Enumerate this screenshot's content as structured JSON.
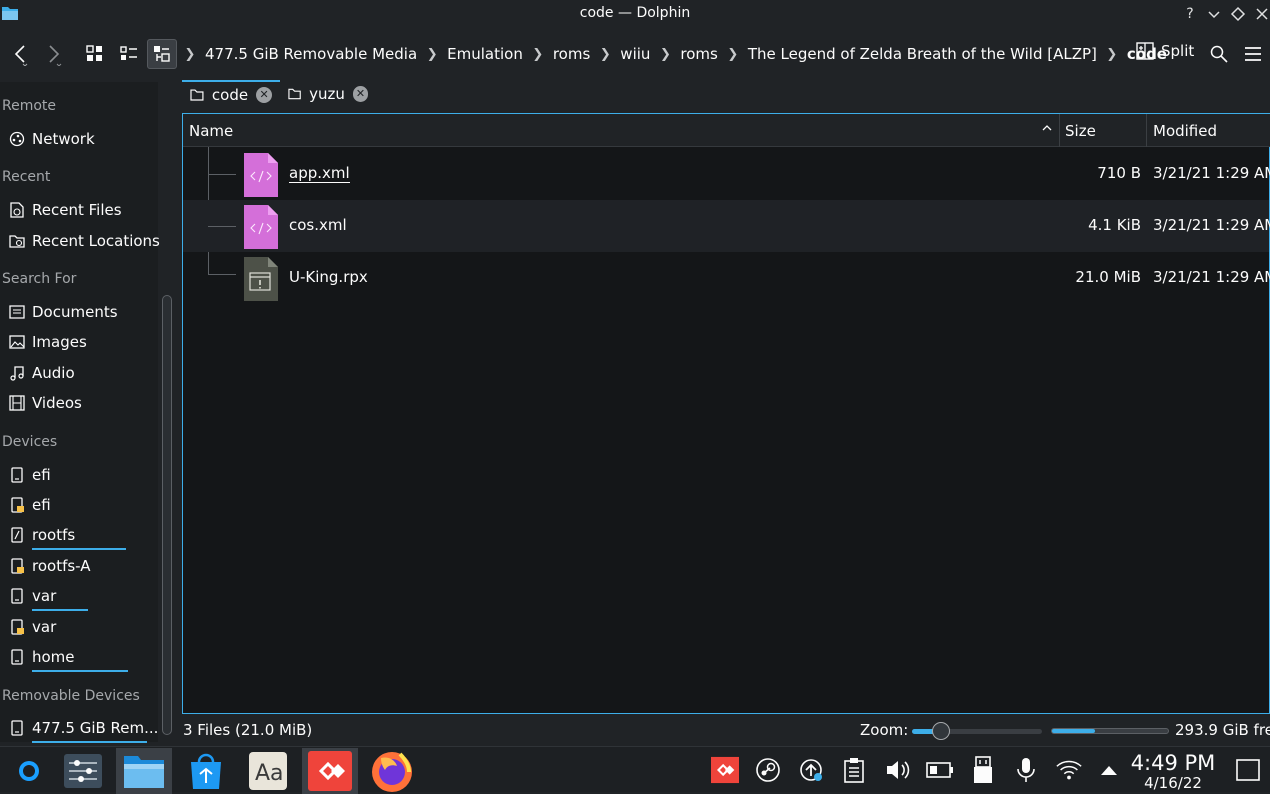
{
  "window": {
    "title": "code — Dolphin"
  },
  "toolbar": {
    "breadcrumb": [
      "477.5 GiB Removable Media",
      "Emulation",
      "roms",
      "wiiu",
      "roms",
      "The Legend of Zelda Breath of the Wild [ALZP]",
      "code"
    ],
    "split_label": "Split"
  },
  "sidebar": {
    "remote_heading": "Remote",
    "network": "Network",
    "recent_heading": "Recent",
    "recent_files": "Recent Files",
    "recent_locations": "Recent Locations",
    "search_heading": "Search For",
    "documents": "Documents",
    "images": "Images",
    "audio": "Audio",
    "videos": "Videos",
    "devices_heading": "Devices",
    "devices": [
      "efi",
      "efi",
      "rootfs",
      "rootfs-A",
      "var",
      "var",
      "home"
    ],
    "device_usage": [
      0,
      0,
      0.84,
      0,
      0.42,
      0,
      0.67
    ],
    "removable_heading": "Removable Devices",
    "removable": "477.5 GiB Rem...",
    "removable_usage": 0.37
  },
  "tabs": [
    {
      "label": "code",
      "active": true
    },
    {
      "label": "yuzu",
      "active": false
    }
  ],
  "columns": {
    "name": "Name",
    "size": "Size",
    "modified": "Modified"
  },
  "files": [
    {
      "name": "app.xml",
      "size": "710 B",
      "modified": "3/21/21 1:29 AM",
      "icon": "xml-file-icon"
    },
    {
      "name": "cos.xml",
      "size": "4.1 KiB",
      "modified": "3/21/21 1:29 AM",
      "icon": "xml-file-icon"
    },
    {
      "name": "U-King.rpx",
      "size": "21.0 MiB",
      "modified": "3/21/21 1:29 AM",
      "icon": "executable-file-icon"
    }
  ],
  "status": {
    "info": "3 Files (21.0 MiB)",
    "zoom_label": "Zoom:",
    "zoom_level": 0.22,
    "free_space": "293.9 GiB free",
    "used_fraction": 0.37
  },
  "taskbar": {
    "apps": [
      "steam-deck-launcher-icon",
      "system-settings-icon",
      "dolphin-file-manager-icon",
      "discover-store-icon",
      "font-viewer-icon",
      "anydesk-icon",
      "firefox-icon"
    ],
    "tray": [
      "anydesk-tray-icon",
      "steam-tray-icon",
      "update-icon",
      "clipboard-icon",
      "volume-icon",
      "battery-icon",
      "usb-storage-icon",
      "microphone-icon",
      "wifi-icon",
      "expand-tray-icon"
    ]
  },
  "clock": {
    "time": "4:49 PM",
    "date": "4/16/22"
  },
  "colors": {
    "accent": "#3daee9",
    "window_bg": "#202326",
    "view_bg": "#141618",
    "xml_icon": "#d46fd9",
    "anydesk": "#ef443b"
  }
}
